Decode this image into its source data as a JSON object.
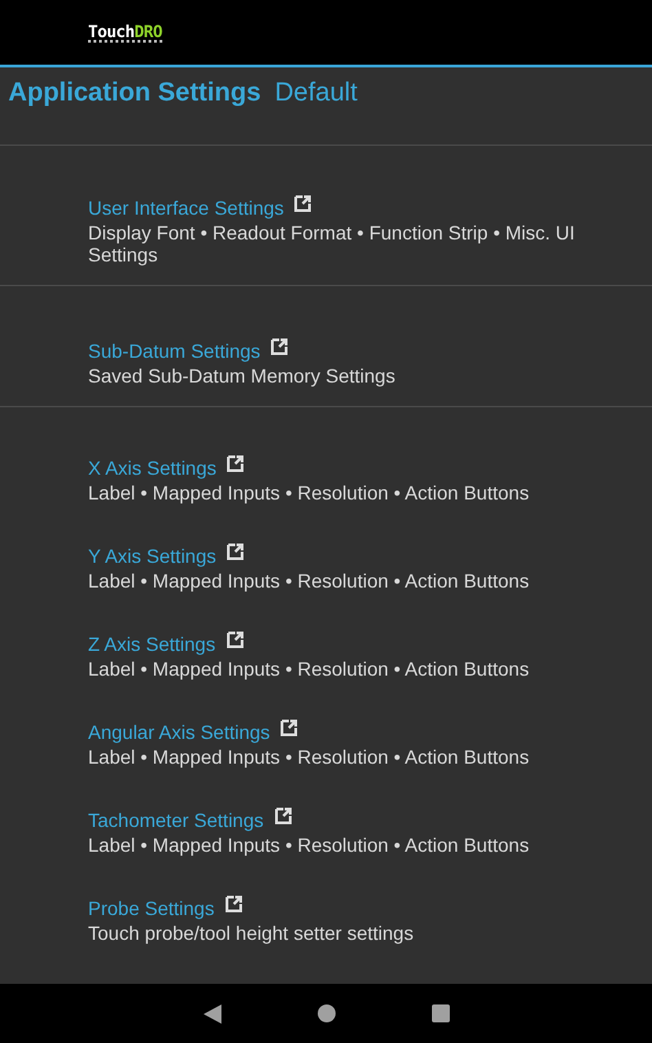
{
  "logo": {
    "part_1": "Touch",
    "part_2": "DRO"
  },
  "header": {
    "title": "Application Settings",
    "subtitle": "Default"
  },
  "groups": [
    {
      "items": [
        {
          "title": "User Interface Settings",
          "summary": "Display Font • Readout Format • Function Strip • Misc. UI Settings"
        }
      ]
    },
    {
      "items": [
        {
          "title": "Sub-Datum Settings",
          "summary": "Saved Sub-Datum Memory Settings"
        }
      ]
    },
    {
      "items": [
        {
          "title": "X Axis Settings",
          "summary": "Label • Mapped Inputs • Resolution • Action Buttons"
        },
        {
          "title": "Y Axis Settings",
          "summary": "Label • Mapped Inputs • Resolution • Action Buttons"
        },
        {
          "title": "Z Axis Settings",
          "summary": "Label • Mapped Inputs • Resolution • Action Buttons"
        },
        {
          "title": "Angular Axis Settings",
          "summary": "Label • Mapped Inputs • Resolution • Action Buttons"
        },
        {
          "title": "Tachometer Settings",
          "summary": "Label • Mapped Inputs • Resolution • Action Buttons"
        },
        {
          "title": "Probe Settings",
          "summary": "Touch probe/tool height setter settings"
        }
      ]
    }
  ]
}
